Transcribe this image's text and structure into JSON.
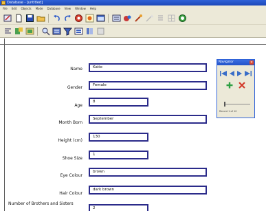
{
  "window": {
    "title": "Database - [untitled]"
  },
  "menu": [
    "File",
    "Edit",
    "Objects",
    "Mode",
    "Database",
    "View",
    "Window",
    "Help"
  ],
  "form": {
    "fields": [
      {
        "label": "Name",
        "value": "Katie"
      },
      {
        "label": "Gender",
        "value": "Female"
      },
      {
        "label": "Age",
        "value": "8"
      },
      {
        "label": "Month Born",
        "value": "September"
      },
      {
        "label": "Height (cm)",
        "value": "130"
      },
      {
        "label": "Shoe Size",
        "value": "1"
      },
      {
        "label": "Eye Colour",
        "value": "brown"
      },
      {
        "label": "Hair Colour",
        "value": "dark brown"
      },
      {
        "label": "Number of Brothers and Sisters",
        "value": "2"
      }
    ]
  },
  "navigator": {
    "title": "Navigator",
    "status": "Record 1 of 10"
  },
  "colors": {
    "field_border": "#2b2b8a",
    "titlebar": "#2f62d8",
    "chrome": "#ece9d8"
  }
}
